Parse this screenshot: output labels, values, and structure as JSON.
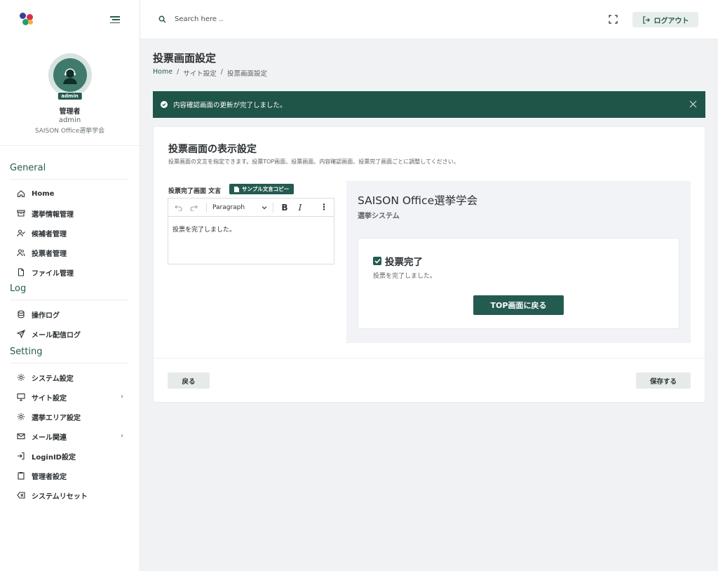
{
  "brand": {
    "logo_colors": [
      "#3b3f99",
      "#d92e4a",
      "#2a9b6a",
      "#f0b23a"
    ]
  },
  "profile": {
    "badge": "admin",
    "role": "管理者",
    "username": "admin",
    "organization": "SAISON Office選挙学会"
  },
  "sidebar": {
    "sections": [
      {
        "heading": "General",
        "items": [
          {
            "label": "Home",
            "icon": "home-icon"
          },
          {
            "label": "選挙情報管理",
            "icon": "archive-icon"
          },
          {
            "label": "候補者管理",
            "icon": "user-check-icon"
          },
          {
            "label": "投票者管理",
            "icon": "users-icon"
          },
          {
            "label": "ファイル管理",
            "icon": "file-icon"
          }
        ]
      },
      {
        "heading": "Log",
        "items": [
          {
            "label": "操作ログ",
            "icon": "database-icon"
          },
          {
            "label": "メール配信ログ",
            "icon": "send-icon"
          }
        ]
      },
      {
        "heading": "Setting",
        "items": [
          {
            "label": "システム設定",
            "icon": "gear-icon"
          },
          {
            "label": "サイト設定",
            "icon": "monitor-icon",
            "has_submenu": true
          },
          {
            "label": "選挙エリア設定",
            "icon": "gear-icon"
          },
          {
            "label": "メール関連",
            "icon": "mail-icon",
            "has_submenu": true
          },
          {
            "label": "LoginID設定",
            "icon": "login-icon"
          },
          {
            "label": "管理者設定",
            "icon": "clipboard-icon"
          },
          {
            "label": "システムリセット",
            "icon": "backspace-icon"
          }
        ]
      }
    ]
  },
  "topbar": {
    "search_placeholder": "Search here ..",
    "logout_label": "ログアウト"
  },
  "page": {
    "title": "投票画面設定",
    "breadcrumb": [
      "Home",
      "サイト設定",
      "投票画面設定"
    ],
    "breadcrumb_sep": "/"
  },
  "alert": {
    "message": "内容確認画面の更新が完了しました。"
  },
  "card": {
    "title": "投票画面の表示設定",
    "description": "投票画面の文言を指定できます。投票TOP画面、投票画面、内容確認画面、投票完了画面ごとに調整してください。",
    "field_label": "投票完了画面 文言",
    "sample_button": "サンプル文言コピー",
    "editor": {
      "format_select": "Paragraph",
      "content": "投票を完了しました。"
    },
    "preview": {
      "organization": "SAISON Office選挙学会",
      "system_name": "選挙システム",
      "heading": "投票完了",
      "message": "投票を完了しました。",
      "button": "TOP画面に戻る"
    },
    "back_button": "戻る",
    "save_button": "保存する"
  }
}
